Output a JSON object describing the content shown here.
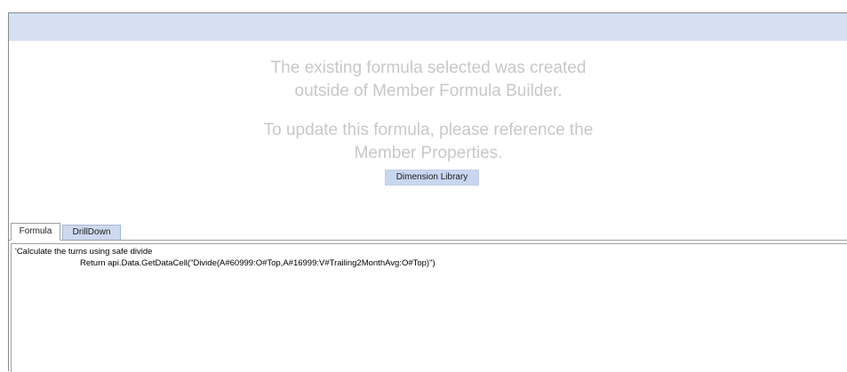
{
  "message": {
    "line1a": "The existing formula selected was created",
    "line1b": "outside of Member Formula Builder.",
    "line2a": "To update this formula, please reference the",
    "line2b": "Member Properties."
  },
  "dimension_library_button": "Dimension Library",
  "tabs": [
    {
      "label": "Formula",
      "active": true
    },
    {
      "label": "DrillDown",
      "active": false
    }
  ],
  "formula": {
    "lines": [
      "'Calculate the turns using safe divide",
      "Return api.Data.GetDataCell(\"Divide(A#60999:O#Top,A#16999:V#Trailing2MonthAvg:O#Top)\")"
    ]
  },
  "colors": {
    "header_bar": "#d6e0f5",
    "message_text": "#c8c8c8",
    "button_bg": "#c9d6f0",
    "inactive_tab_bg": "#cdd9ef"
  }
}
